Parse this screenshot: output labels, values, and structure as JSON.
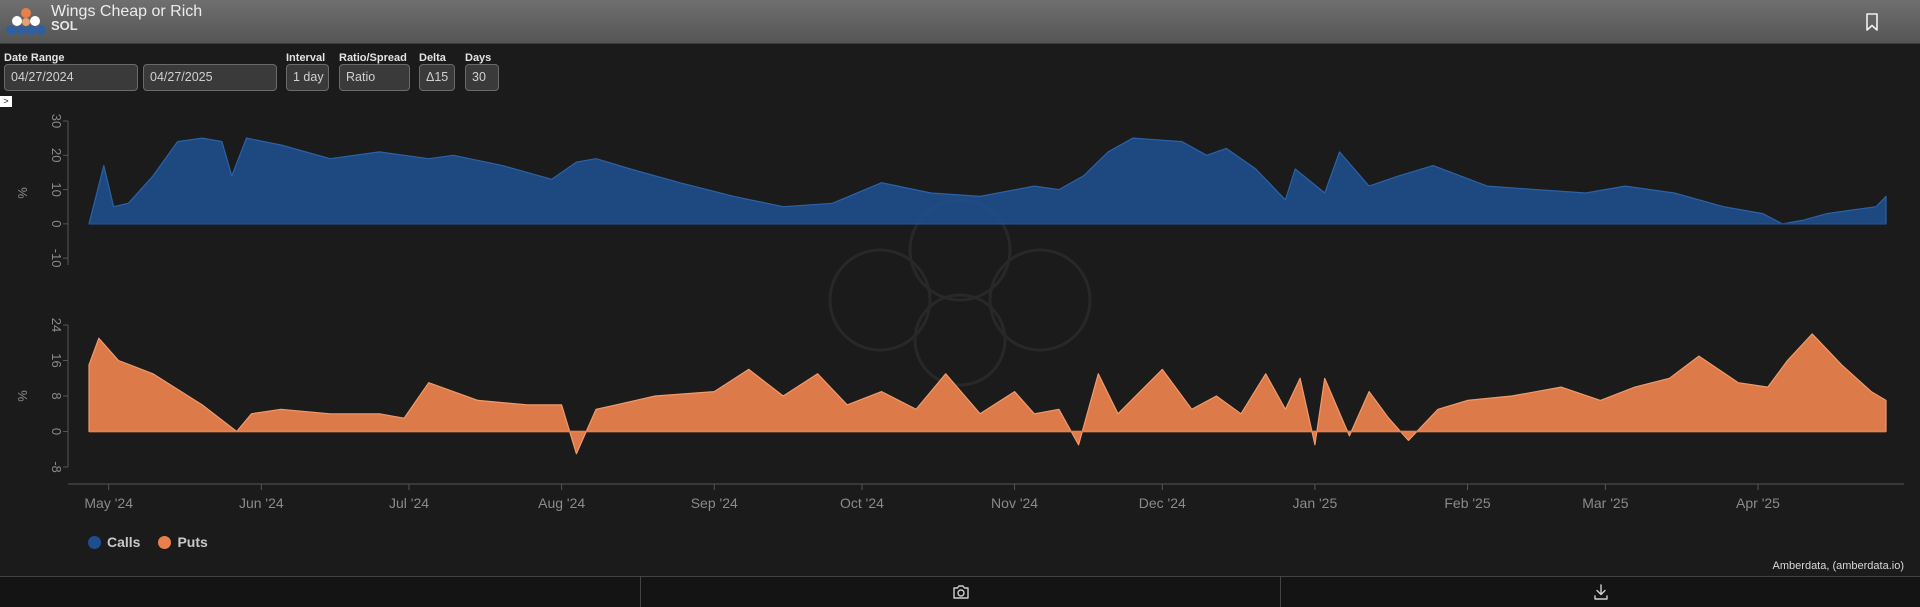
{
  "header": {
    "title": "Wings Cheap or Rich",
    "subtitle": "SOL"
  },
  "controls": [
    {
      "label": "Date Range",
      "value": "04/27/2024"
    },
    {
      "label": "",
      "value": "04/27/2025"
    },
    {
      "label": "Interval",
      "value": "1 day"
    },
    {
      "label": "Ratio/Spread",
      "value": "Ratio"
    },
    {
      "label": "Delta",
      "value": "Δ15"
    },
    {
      "label": "Days",
      "value": "30"
    }
  ],
  "collapse_glyph": ">",
  "legend": [
    {
      "name": "Calls",
      "color": "#1f4e8c"
    },
    {
      "name": "Puts",
      "color": "#e8804c"
    }
  ],
  "credit": "Amberdata, (amberdata.io)",
  "footer_icons": [
    "camera-icon",
    "download-icon"
  ],
  "chart_data": [
    {
      "type": "area",
      "series": [
        {
          "name": "Calls",
          "color": "#1f4e8c",
          "x": [
            "2024-04-27",
            "2024-04-30",
            "2024-05-02",
            "2024-05-05",
            "2024-05-10",
            "2024-05-15",
            "2024-05-20",
            "2024-05-24",
            "2024-05-26",
            "2024-05-29",
            "2024-06-05",
            "2024-06-15",
            "2024-06-25",
            "2024-07-05",
            "2024-07-10",
            "2024-07-20",
            "2024-07-30",
            "2024-08-04",
            "2024-08-08",
            "2024-08-15",
            "2024-08-25",
            "2024-09-05",
            "2024-09-15",
            "2024-09-25",
            "2024-10-05",
            "2024-10-15",
            "2024-10-25",
            "2024-11-05",
            "2024-11-10",
            "2024-11-15",
            "2024-11-20",
            "2024-11-25",
            "2024-12-05",
            "2024-12-10",
            "2024-12-14",
            "2024-12-20",
            "2024-12-26",
            "2024-12-28",
            "2025-01-03",
            "2025-01-06",
            "2025-01-12",
            "2025-01-18",
            "2025-01-25",
            "2025-02-05",
            "2025-02-15",
            "2025-02-25",
            "2025-03-05",
            "2025-03-15",
            "2025-03-25",
            "2025-04-02",
            "2025-04-06",
            "2025-04-10",
            "2025-04-15",
            "2025-04-20",
            "2025-04-25",
            "2025-04-27"
          ],
          "values": [
            0,
            17,
            5,
            6,
            14,
            24,
            25,
            24,
            14,
            25,
            23,
            19,
            21,
            19,
            20,
            17,
            13,
            18,
            19,
            16,
            12,
            8,
            5,
            6,
            12,
            9,
            8,
            11,
            10,
            14,
            21,
            25,
            24,
            20,
            22,
            16,
            7,
            16,
            9,
            21,
            11,
            14,
            17,
            11,
            10,
            9,
            11,
            9,
            5,
            3,
            0,
            1,
            3,
            4,
            5,
            8
          ],
          "ylim": [
            -12,
            30
          ],
          "yticks": [
            -10,
            0,
            10,
            20,
            30
          ],
          "ylabel": "%"
        }
      ]
    },
    {
      "type": "area",
      "series": [
        {
          "name": "Puts",
          "color": "#e8804c",
          "x": [
            "2024-04-27",
            "2024-04-29",
            "2024-05-03",
            "2024-05-10",
            "2024-05-20",
            "2024-05-27",
            "2024-05-30",
            "2024-06-05",
            "2024-06-15",
            "2024-06-25",
            "2024-06-30",
            "2024-07-05",
            "2024-07-15",
            "2024-07-25",
            "2024-08-01",
            "2024-08-04",
            "2024-08-08",
            "2024-08-12",
            "2024-08-20",
            "2024-09-01",
            "2024-09-08",
            "2024-09-15",
            "2024-09-22",
            "2024-09-28",
            "2024-10-05",
            "2024-10-12",
            "2024-10-18",
            "2024-10-25",
            "2024-11-01",
            "2024-11-05",
            "2024-11-10",
            "2024-11-14",
            "2024-11-18",
            "2024-11-22",
            "2024-12-01",
            "2024-12-07",
            "2024-12-12",
            "2024-12-17",
            "2024-12-22",
            "2024-12-26",
            "2024-12-29",
            "2025-01-01",
            "2025-01-03",
            "2025-01-08",
            "2025-01-12",
            "2025-01-16",
            "2025-01-20",
            "2025-01-26",
            "2025-02-01",
            "2025-02-10",
            "2025-02-20",
            "2025-02-28",
            "2025-03-07",
            "2025-03-14",
            "2025-03-20",
            "2025-03-28",
            "2025-04-03",
            "2025-04-07",
            "2025-04-12",
            "2025-04-18",
            "2025-04-24",
            "2025-04-27"
          ],
          "values": [
            15,
            21,
            16,
            13,
            6,
            0,
            4,
            5,
            4,
            4,
            3,
            11,
            7,
            6,
            6,
            -5,
            5,
            6,
            8,
            9,
            14,
            8,
            13,
            6,
            9,
            5,
            13,
            4,
            9,
            4,
            5,
            -3,
            13,
            4,
            14,
            5,
            8,
            4,
            13,
            5,
            12,
            -3,
            12,
            -1,
            9,
            3,
            -2,
            5,
            7,
            8,
            10,
            7,
            10,
            12,
            17,
            11,
            10,
            16,
            22,
            15,
            9,
            7
          ],
          "ylim": [
            -8,
            24
          ],
          "yticks": [
            -8,
            0,
            8,
            16,
            24
          ],
          "ylabel": "%"
        }
      ]
    }
  ],
  "x_axis": {
    "ticks": [
      {
        "date": "2024-05-01",
        "label": "May '24"
      },
      {
        "date": "2024-06-01",
        "label": "Jun '24"
      },
      {
        "date": "2024-07-01",
        "label": "Jul '24"
      },
      {
        "date": "2024-08-01",
        "label": "Aug '24"
      },
      {
        "date": "2024-09-01",
        "label": "Sep '24"
      },
      {
        "date": "2024-10-01",
        "label": "Oct '24"
      },
      {
        "date": "2024-11-01",
        "label": "Nov '24"
      },
      {
        "date": "2024-12-01",
        "label": "Dec '24"
      },
      {
        "date": "2025-01-01",
        "label": "Jan '25"
      },
      {
        "date": "2025-02-01",
        "label": "Feb '25"
      },
      {
        "date": "2025-03-01",
        "label": "Mar '25"
      },
      {
        "date": "2025-04-01",
        "label": "Apr '25"
      }
    ],
    "range": [
      "2024-04-27",
      "2025-04-27"
    ]
  }
}
